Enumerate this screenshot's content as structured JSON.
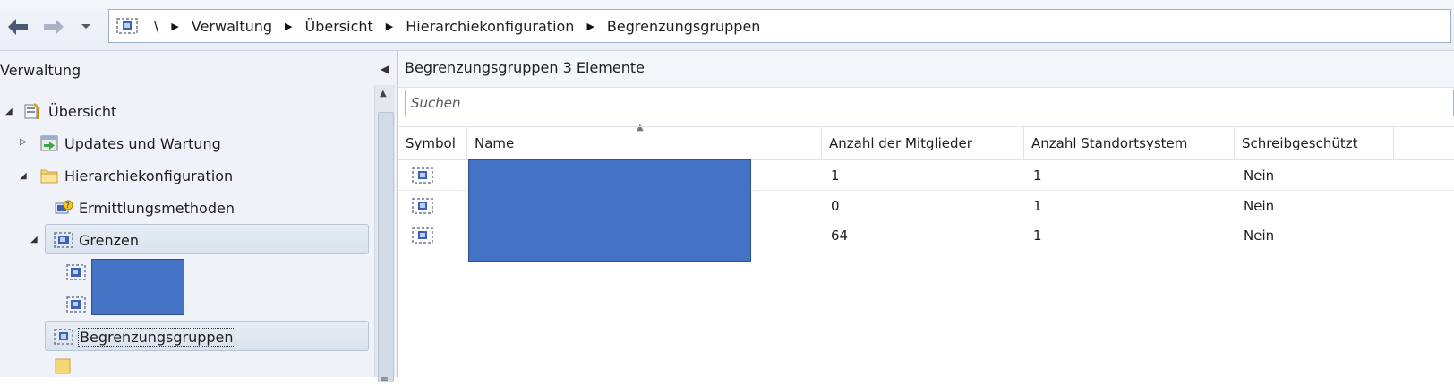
{
  "nav": {
    "back_icon": "arrow-left-icon",
    "forward_icon": "arrow-right-icon",
    "dropdown_icon": "chevron-down-icon",
    "breadcrumb": [
      "\\",
      "Verwaltung",
      "Übersicht",
      "Hierarchiekonfiguration",
      "Begrenzungsgruppen"
    ]
  },
  "left": {
    "title": "Verwaltung",
    "tree": {
      "overview": "Übersicht",
      "updates": "Updates und Wartung",
      "hierarchy": "Hierarchiekonfiguration",
      "discovery": "Ermittlungsmethoden",
      "boundaries": "Grenzen",
      "boundary_groups": "Begrenzungsgruppen"
    }
  },
  "content": {
    "title": "Begrenzungsgruppen",
    "count": "3 Elemente",
    "search_placeholder": "Suchen",
    "columns": [
      "Symbol",
      "Name",
      "Anzahl der Mitglieder",
      "Anzahl Standortsystem",
      "Schreibgeschützt"
    ],
    "rows": [
      {
        "members": "1",
        "sites": "1",
        "readonly": "Nein"
      },
      {
        "members": "0",
        "sites": "1",
        "readonly": "Nein"
      },
      {
        "members": "64",
        "sites": "1",
        "readonly": "Nein"
      }
    ]
  },
  "colors": {
    "redaction": "#4472c4",
    "pane_background": "#eff3f9",
    "selection": "#d9e2ee"
  }
}
